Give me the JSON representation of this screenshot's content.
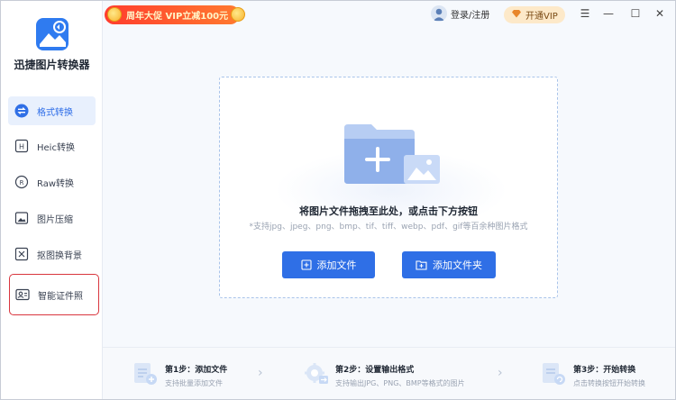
{
  "app": {
    "name": "迅捷图片转换器"
  },
  "promo": {
    "text": "周年大促 VIP立减100元"
  },
  "topbar": {
    "login_label": "登录/注册",
    "vip_label": "开通VIP"
  },
  "window_controls": [
    {
      "icon": "menu-icon",
      "glyph": "☰"
    },
    {
      "icon": "minimize-icon",
      "glyph": "—"
    },
    {
      "icon": "maximize-icon",
      "glyph": "☐"
    },
    {
      "icon": "close-icon",
      "glyph": "✕"
    }
  ],
  "sidebar": {
    "items": [
      {
        "label": "格式转换",
        "icon": "format-convert-icon",
        "active": true
      },
      {
        "label": "Heic转换",
        "icon": "heic-icon",
        "active": false
      },
      {
        "label": "Raw转换",
        "icon": "raw-icon",
        "active": false
      },
      {
        "label": "图片压缩",
        "icon": "compress-icon",
        "active": false
      },
      {
        "label": "抠图换背景",
        "icon": "cutout-icon",
        "active": false
      },
      {
        "label": "智能证件照",
        "icon": "id-photo-icon",
        "active": false,
        "highlighted": true
      }
    ]
  },
  "dropzone": {
    "title": "将图片文件拖拽至此处，或点击下方按钮",
    "subtitle": "*支持jpg、jpeg、png、bmp、tif、tiff、webp、pdf、gif等百余种图片格式",
    "add_file_label": "添加文件",
    "add_folder_label": "添加文件夹"
  },
  "steps": [
    {
      "title": "第1步：添加文件",
      "desc": "支持批量添加文件"
    },
    {
      "title": "第2步：设置输出格式",
      "desc": "支持输出JPG、PNG、BMP等格式的图片"
    },
    {
      "title": "第3步：开始转换",
      "desc": "点击转换按钮开始转换"
    }
  ],
  "colors": {
    "accent": "#2f6fe6",
    "highlight_border": "#d9363e",
    "promo": "#ff3d2e"
  }
}
